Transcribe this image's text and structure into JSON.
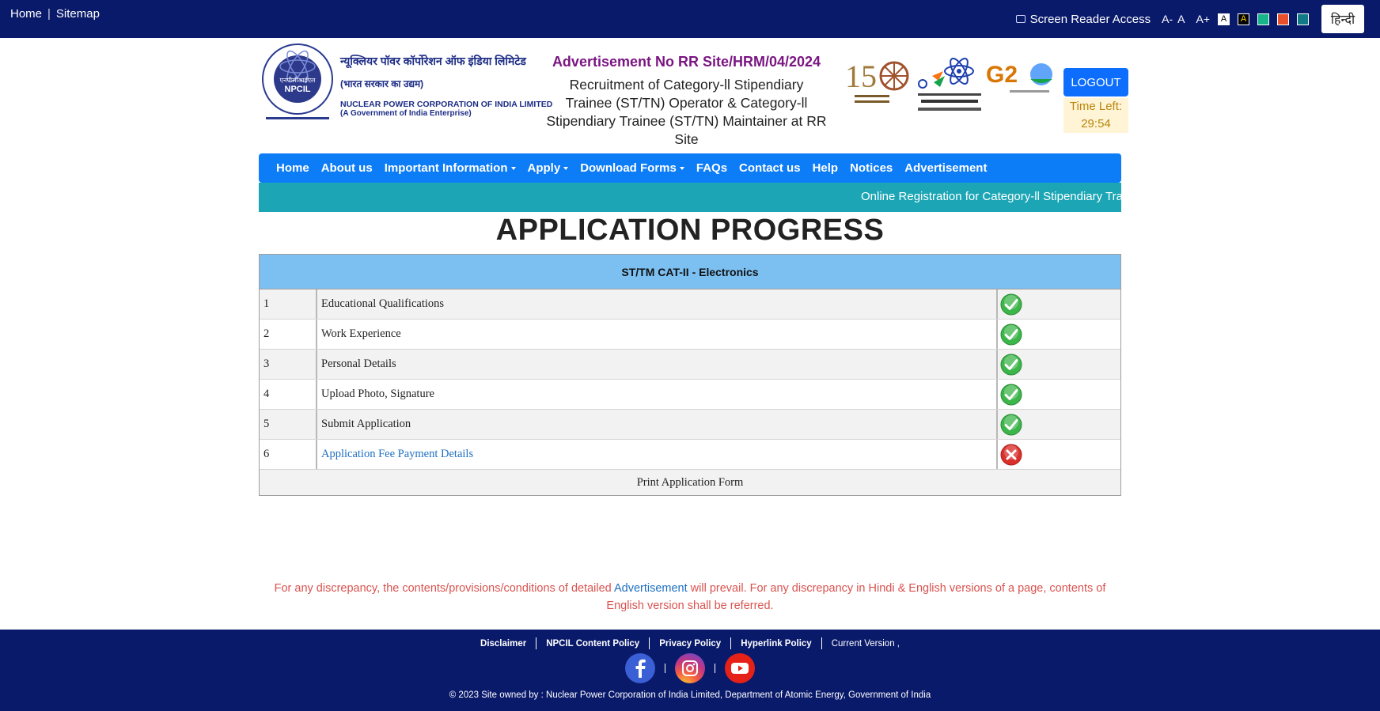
{
  "topbar": {
    "home": "Home",
    "sitemap": "Sitemap",
    "screen_reader": "Screen Reader Access",
    "font_decrease": "A-",
    "font_normal": "A",
    "font_increase": "A+",
    "swatch_white": "A",
    "swatch_black": "A",
    "hindi": "हिन्दी"
  },
  "header": {
    "org_hindi": "न्यूक्लियर पॉवर कॉर्पोरेशन ऑफ इंडिया लिमिटेड",
    "org_hindi_sub": "(भारत सरकार का उद्यम)",
    "org_english": "NUCLEAR POWER CORPORATION OF INDIA LIMITED",
    "org_english_sub": "(A Government of India Enterprise)",
    "logo_text": "एनपीसीआईएल NPCIL",
    "advertisement_no": "Advertisement No RR Site/HRM/04/2024",
    "advertisement_title": "Recruitment of Category-ll Stipendiary Trainee (ST/TN) Operator & Category-ll Stipendiary Trainee (ST/TN) Maintainer at RR Site",
    "logout": "LOGOUT",
    "time_left_label": "Time Left:",
    "time_left_value": "29:54"
  },
  "nav": {
    "items": [
      {
        "label": "Home",
        "dropdown": false
      },
      {
        "label": "About us",
        "dropdown": false
      },
      {
        "label": "Important Information",
        "dropdown": true
      },
      {
        "label": "Apply",
        "dropdown": true
      },
      {
        "label": "Download Forms",
        "dropdown": true
      },
      {
        "label": "FAQs",
        "dropdown": false
      },
      {
        "label": "Contact us",
        "dropdown": false
      },
      {
        "label": "Help",
        "dropdown": false
      },
      {
        "label": "Notices",
        "dropdown": false
      },
      {
        "label": "Advertisement",
        "dropdown": false
      }
    ]
  },
  "ticker": {
    "text": "Online Registration for Category-ll Stipendiary Trai"
  },
  "main": {
    "title": "APPLICATION PROGRESS",
    "post": "ST/TM CAT-II - Electronics",
    "rows": [
      {
        "no": "1",
        "name": "Educational Qualifications",
        "status": "complete",
        "link": false
      },
      {
        "no": "2",
        "name": "Work Experience",
        "status": "complete",
        "link": false
      },
      {
        "no": "3",
        "name": "Personal Details",
        "status": "complete",
        "link": false
      },
      {
        "no": "4",
        "name": "Upload Photo, Signature",
        "status": "complete",
        "link": false
      },
      {
        "no": "5",
        "name": "Submit Application",
        "status": "complete",
        "link": false
      },
      {
        "no": "6",
        "name": "Application Fee Payment Details",
        "status": "incomplete",
        "link": true
      }
    ],
    "print": "Print Application Form"
  },
  "disclaimer": {
    "before": "For any discrepancy, the contents/provisions/conditions of detailed ",
    "link": "Advertisement",
    "after": " will prevail. For any discrepancy in Hindi & English versions of a page, contents of English version shall be referred."
  },
  "footer": {
    "links": [
      "Disclaimer",
      "NPCIL Content Policy",
      "Privacy Policy",
      "Hyperlink Policy"
    ],
    "version": "Current Version ,",
    "socials": [
      "facebook-icon",
      "instagram-icon",
      "youtube-icon"
    ],
    "copyright": "© 2023 Site owned by : Nuclear Power Corporation of India Limited, Department of Atomic Energy, Government of India"
  },
  "colors": {
    "topbar_bg": "#0a1a6b",
    "nav_bg": "#0d7cf7",
    "ticker_bg": "#1ca6b5",
    "table_head_bg": "#7cc0f2",
    "advert_purple": "#7a1682",
    "disclaimer_red": "#d9534f",
    "status_ok": "#3cb54a",
    "status_fail": "#d9302c"
  }
}
